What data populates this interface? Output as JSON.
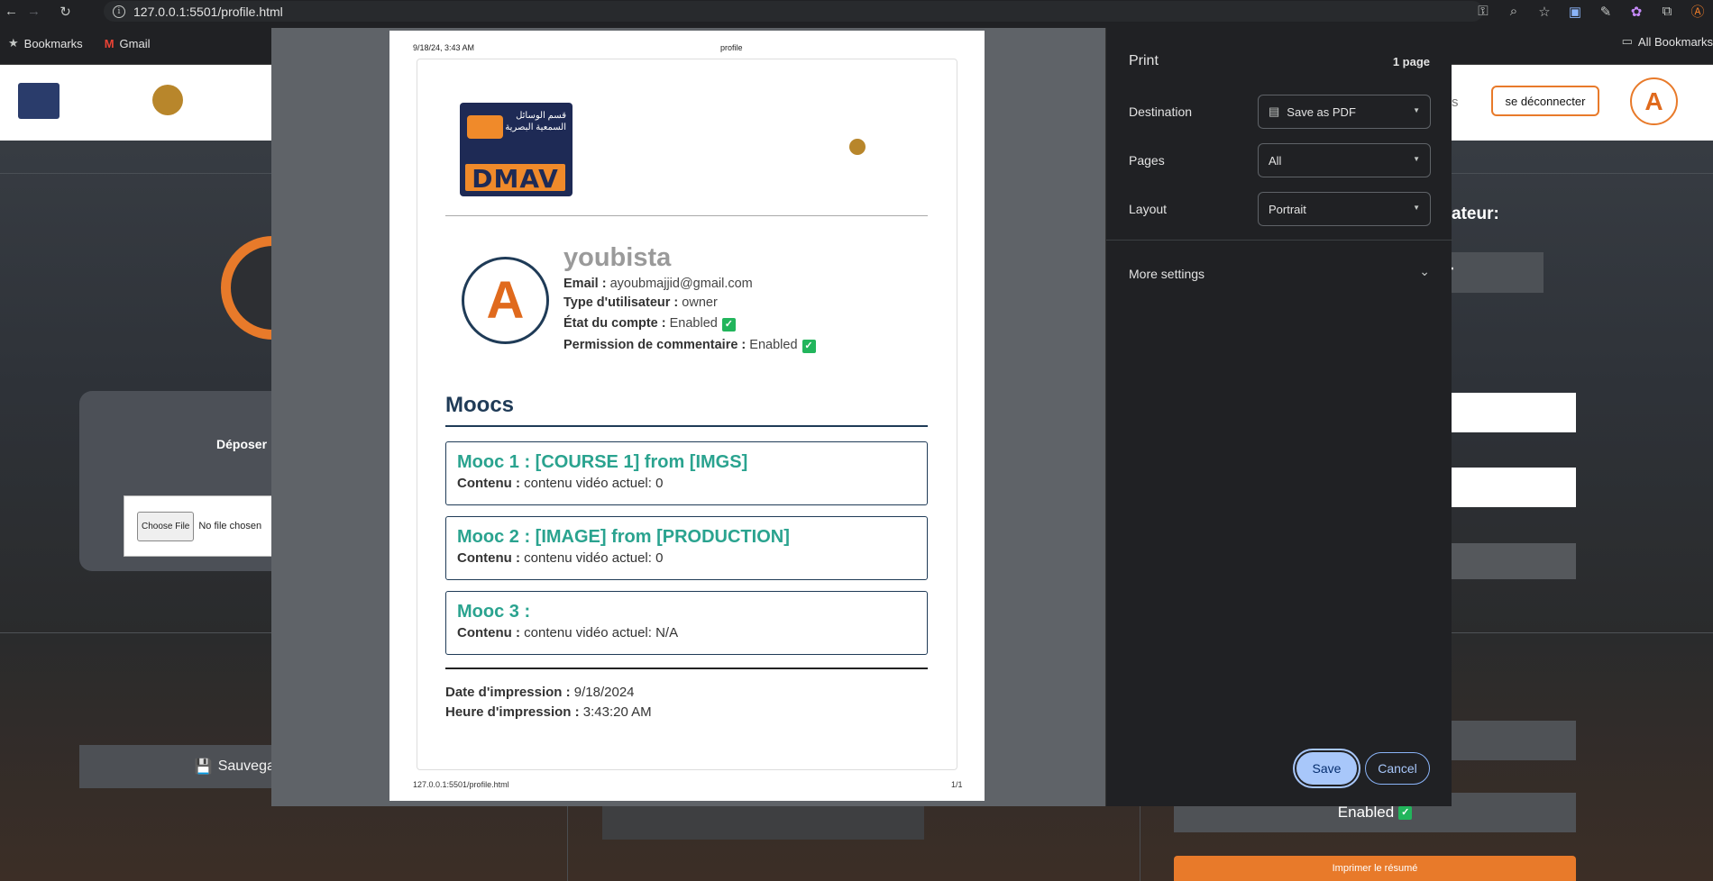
{
  "browser": {
    "url": "127.0.0.1:5501/profile.html",
    "bookmarks": [
      {
        "label": "Bookmarks",
        "icon": "star-icon"
      },
      {
        "label": "Gmail",
        "icon": "gmail-icon"
      }
    ],
    "all_bookmarks": "All Bookmarks"
  },
  "background": {
    "logout": "se déconnecter",
    "s_fragment": "s",
    "deposer": "Déposer",
    "choose_file": "Choose File",
    "no_file": "No file chosen",
    "save": "Sauvegarde",
    "right_title": "ateur:",
    "r_fragment": "r",
    "enabled": "Enabled",
    "print_resume": "Imprimer le résumé"
  },
  "sheet": {
    "date_header": "9/18/24, 3:43 AM",
    "title_header": "profile",
    "logo_text": "DMAV",
    "logo_arabic": "قسم الوسائل السمعية البصرية",
    "username": "youbista",
    "email_label": "Email :",
    "email": "ayoubmajjid@gmail.com",
    "type_label": "Type d'utilisateur :",
    "type": "owner",
    "state_label": "État du compte :",
    "state": "Enabled",
    "perm_label": "Permission de commentaire :",
    "perm": "Enabled",
    "moocs_title": "Moocs",
    "moocs": [
      {
        "title": "Mooc 1 : [COURSE 1] from [IMGS]",
        "content_label": "Contenu :",
        "content": "contenu vidéo actuel: 0"
      },
      {
        "title": "Mooc 2 : [IMAGE] from [PRODUCTION]",
        "content_label": "Contenu :",
        "content": "contenu vidéo actuel: 0"
      },
      {
        "title": "Mooc 3 :",
        "content_label": "Contenu :",
        "content": "contenu vidéo actuel: N/A"
      }
    ],
    "print_date_label": "Date d'impression :",
    "print_date": "9/18/2024",
    "print_time_label": "Heure d'impression :",
    "print_time": "3:43:20 AM",
    "footer_url": "127.0.0.1:5501/profile.html",
    "footer_page": "1/1"
  },
  "print_panel": {
    "title": "Print",
    "page_count": "1 page",
    "destination_label": "Destination",
    "destination_value": "Save as PDF",
    "pages_label": "Pages",
    "pages_value": "All",
    "layout_label": "Layout",
    "layout_value": "Portrait",
    "more_settings": "More settings",
    "save": "Save",
    "cancel": "Cancel"
  }
}
